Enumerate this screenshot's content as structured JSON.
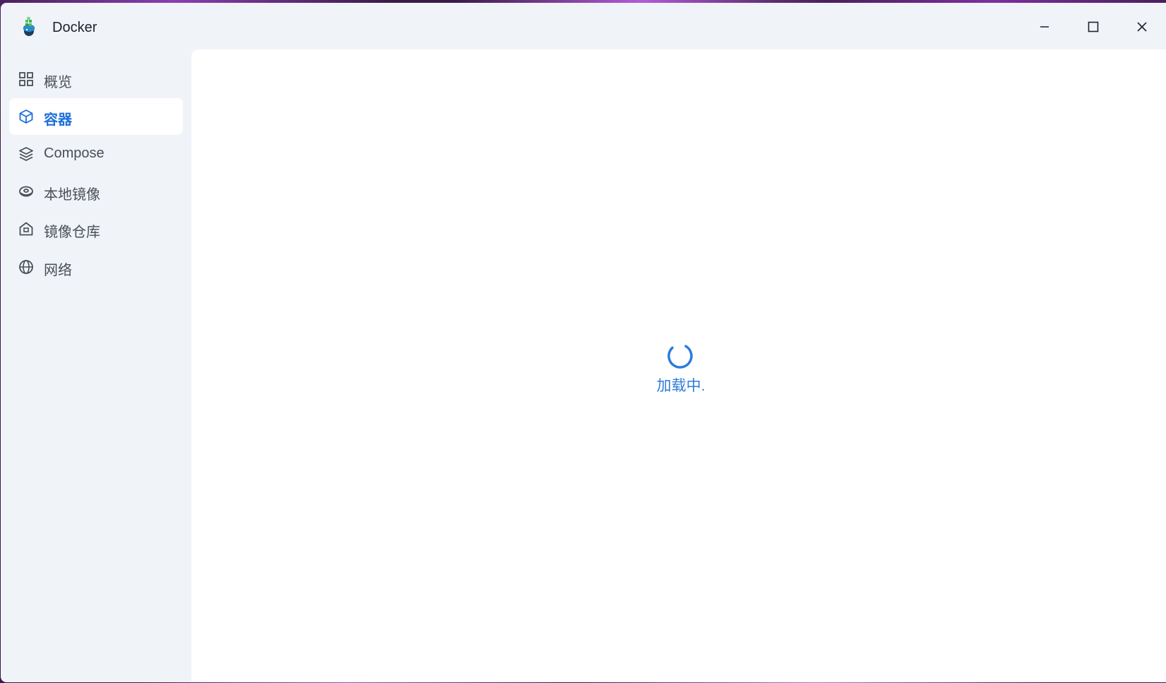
{
  "window": {
    "title": "Docker",
    "logo_icon": "docker-whale-icon",
    "controls": {
      "minimize_icon": "minimize-icon",
      "maximize_icon": "maximize-icon",
      "close_icon": "close-icon"
    }
  },
  "sidebar": {
    "items": [
      {
        "label": "概览",
        "icon": "grid-icon",
        "active": false
      },
      {
        "label": "容器",
        "icon": "cube-icon",
        "active": true
      },
      {
        "label": "Compose",
        "icon": "layers-icon",
        "active": false
      },
      {
        "label": "本地镜像",
        "icon": "disk-image-icon",
        "active": false
      },
      {
        "label": "镜像仓库",
        "icon": "warehouse-icon",
        "active": false
      },
      {
        "label": "网络",
        "icon": "globe-icon",
        "active": false
      }
    ]
  },
  "main": {
    "loading_text": "加载中."
  },
  "colors": {
    "accent": "#1e6fdb",
    "sidebar_bg": "#f0f3f8",
    "content_bg": "#ffffff",
    "text_default": "#4a4f57"
  }
}
